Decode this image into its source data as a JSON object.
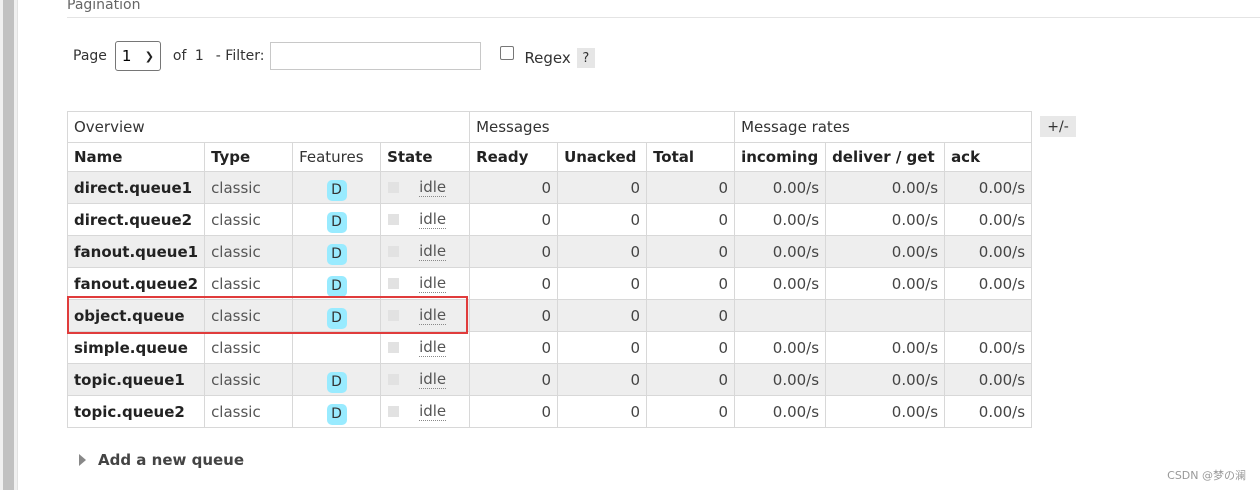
{
  "section_title": "Pagination",
  "pagination": {
    "page_label": "Page",
    "page_value": "1",
    "of_label": "of",
    "total_pages": "1",
    "filter_label": "- Filter:",
    "filter_value": "",
    "regex_label": "Regex",
    "help_label": "?"
  },
  "table": {
    "groups": [
      "Overview",
      "Messages",
      "Message rates"
    ],
    "columns": [
      "Name",
      "Type",
      "Features",
      "State",
      "Ready",
      "Unacked",
      "Total",
      "incoming",
      "deliver / get",
      "ack"
    ],
    "toggle_label": "+/-",
    "rows": [
      {
        "name": "direct.queue1",
        "type": "classic",
        "feature": "D",
        "state": "idle",
        "ready": "0",
        "unacked": "0",
        "total": "0",
        "incoming": "0.00/s",
        "deliver": "0.00/s",
        "ack": "0.00/s"
      },
      {
        "name": "direct.queue2",
        "type": "classic",
        "feature": "D",
        "state": "idle",
        "ready": "0",
        "unacked": "0",
        "total": "0",
        "incoming": "0.00/s",
        "deliver": "0.00/s",
        "ack": "0.00/s"
      },
      {
        "name": "fanout.queue1",
        "type": "classic",
        "feature": "D",
        "state": "idle",
        "ready": "0",
        "unacked": "0",
        "total": "0",
        "incoming": "0.00/s",
        "deliver": "0.00/s",
        "ack": "0.00/s"
      },
      {
        "name": "fanout.queue2",
        "type": "classic",
        "feature": "D",
        "state": "idle",
        "ready": "0",
        "unacked": "0",
        "total": "0",
        "incoming": "0.00/s",
        "deliver": "0.00/s",
        "ack": "0.00/s"
      },
      {
        "name": "object.queue",
        "type": "classic",
        "feature": "D",
        "state": "idle",
        "ready": "0",
        "unacked": "0",
        "total": "0",
        "incoming": "",
        "deliver": "",
        "ack": ""
      },
      {
        "name": "simple.queue",
        "type": "classic",
        "feature": "",
        "state": "idle",
        "ready": "0",
        "unacked": "0",
        "total": "0",
        "incoming": "0.00/s",
        "deliver": "0.00/s",
        "ack": "0.00/s"
      },
      {
        "name": "topic.queue1",
        "type": "classic",
        "feature": "D",
        "state": "idle",
        "ready": "0",
        "unacked": "0",
        "total": "0",
        "incoming": "0.00/s",
        "deliver": "0.00/s",
        "ack": "0.00/s"
      },
      {
        "name": "topic.queue2",
        "type": "classic",
        "feature": "D",
        "state": "idle",
        "ready": "0",
        "unacked": "0",
        "total": "0",
        "incoming": "0.00/s",
        "deliver": "0.00/s",
        "ack": "0.00/s"
      }
    ]
  },
  "add_queue_label": "Add a new queue",
  "watermark": "CSDN @梦の澜",
  "colors": {
    "feature_badge": "#99ebff",
    "highlight": "#e03c3c",
    "row_alt": "#eeeeee"
  },
  "icons": {
    "dropdown": "chevron-down-icon",
    "expand": "triangle-right-icon"
  }
}
